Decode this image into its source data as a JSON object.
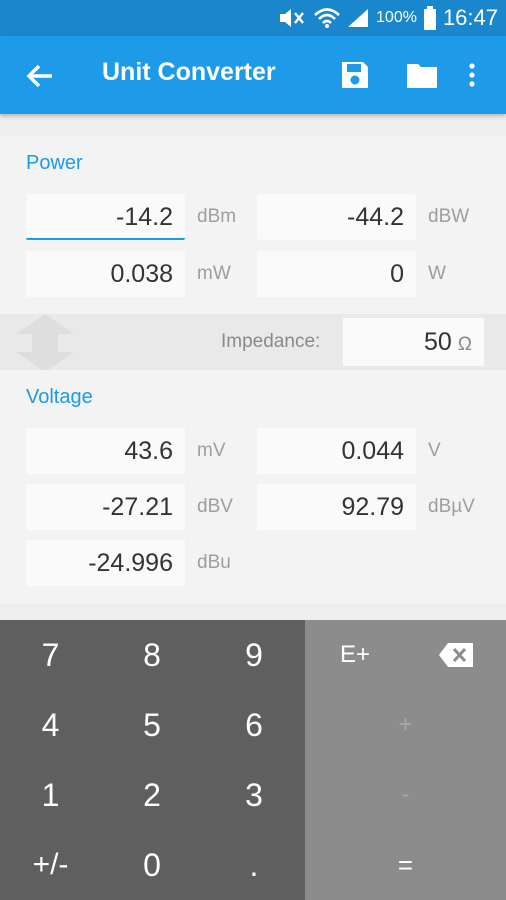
{
  "status_bar": {
    "battery": "100%",
    "time": "16:47"
  },
  "app_bar": {
    "title": "Unit Converter"
  },
  "power": {
    "title": "Power",
    "dbm": {
      "value": "-14.2",
      "unit": "dBm"
    },
    "dbw": {
      "value": "-44.2",
      "unit": "dBW"
    },
    "mw": {
      "value": "0.038",
      "unit": "mW"
    },
    "w": {
      "value": "0",
      "unit": "W"
    }
  },
  "impedance": {
    "label": "Impedance:",
    "value": "50",
    "unit": "Ω"
  },
  "voltage": {
    "title": "Voltage",
    "mv": {
      "value": "43.6",
      "unit": "mV"
    },
    "v": {
      "value": "0.044",
      "unit": "V"
    },
    "dbv": {
      "value": "-27.21",
      "unit": "dBV"
    },
    "dbuv": {
      "value": "92.79",
      "unit": "dBµV"
    },
    "dbu": {
      "value": "-24.996",
      "unit": "dBu"
    }
  },
  "keypad": {
    "k7": "7",
    "k8": "8",
    "k9": "9",
    "k4": "4",
    "k5": "5",
    "k6": "6",
    "k1": "1",
    "k2": "2",
    "k3": "3",
    "sign": "+/-",
    "k0": "0",
    "dot": ".",
    "eplus": "E+",
    "plus": "+",
    "minus": "-",
    "equals": "="
  }
}
